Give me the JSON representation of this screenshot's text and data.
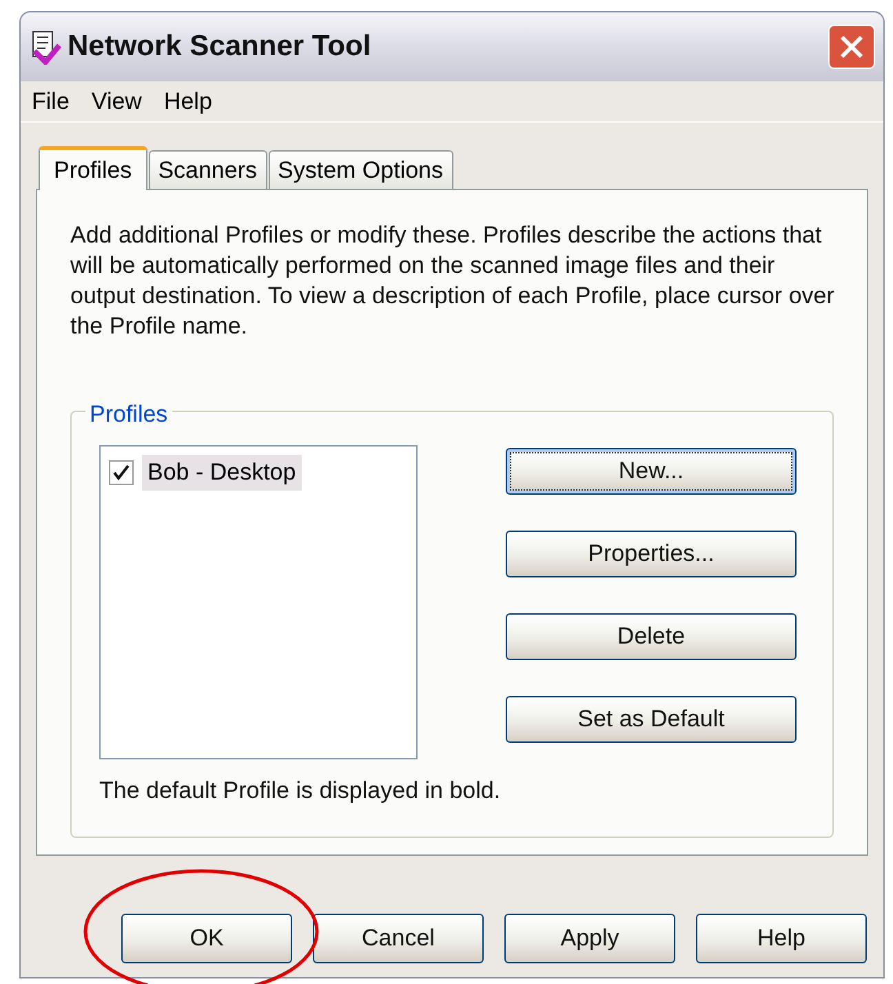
{
  "window": {
    "title": "Network Scanner Tool"
  },
  "menu": [
    "File",
    "View",
    "Help"
  ],
  "tabs": [
    {
      "label": "Profiles",
      "selected": true
    },
    {
      "label": "Scanners",
      "selected": false
    },
    {
      "label": "System Options",
      "selected": false
    }
  ],
  "description": "Add additional Profiles or modify these. Profiles describe the actions that will be automatically performed on the scanned image files and their output destination. To view a description of each  Profile, place cursor over the Profile name.",
  "profiles_group": {
    "title": "Profiles",
    "items": [
      {
        "label": "Bob - Desktop",
        "checked": true,
        "selected": true
      }
    ],
    "buttons": [
      {
        "label": "New...",
        "focused": true
      },
      {
        "label": "Properties...",
        "focused": false
      },
      {
        "label": "Delete",
        "focused": false
      },
      {
        "label": "Set as Default",
        "focused": false
      }
    ],
    "note": "The default Profile is displayed in bold."
  },
  "dialog_buttons": [
    {
      "label": "OK",
      "circled": true
    },
    {
      "label": "Cancel",
      "circled": false
    },
    {
      "label": "Apply",
      "circled": false
    },
    {
      "label": "Help",
      "circled": false
    }
  ]
}
